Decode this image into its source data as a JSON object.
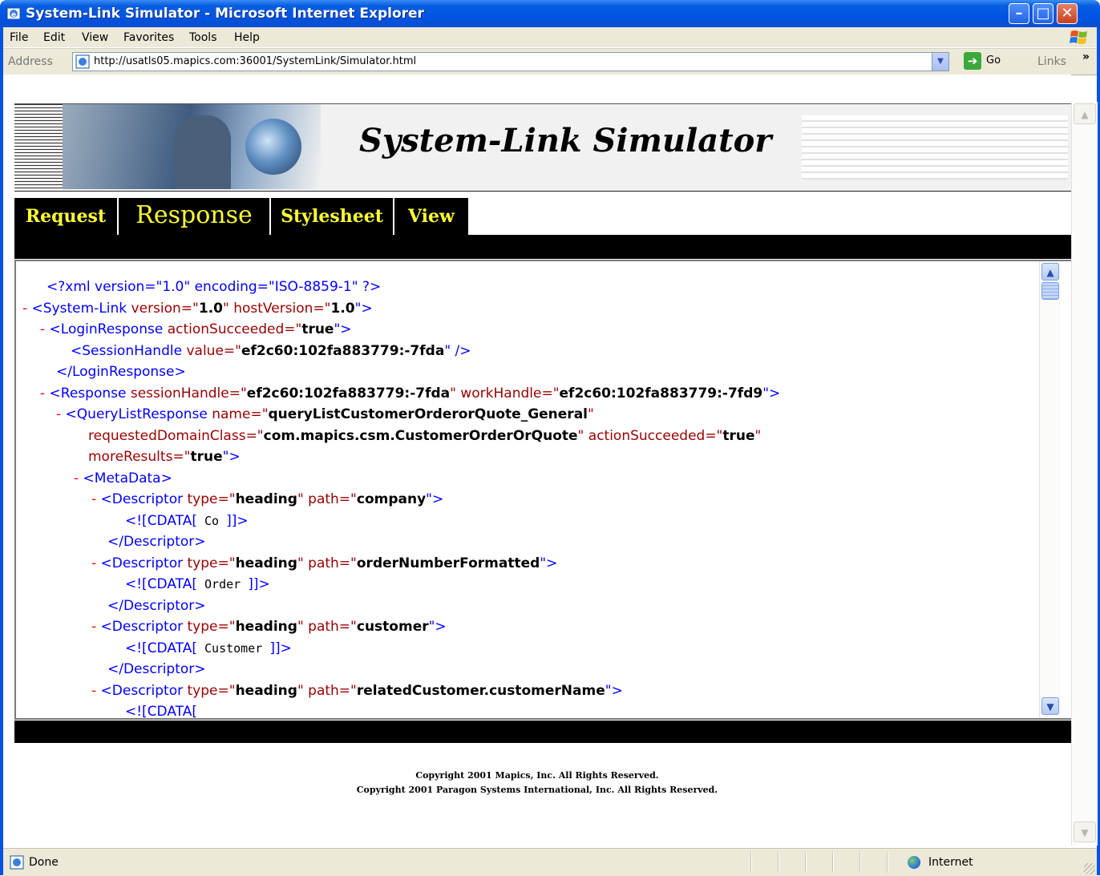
{
  "window": {
    "title": "System-Link Simulator - Microsoft Internet Explorer",
    "min_glyph": "–",
    "max_glyph": "□",
    "close_glyph": "✕"
  },
  "menu": [
    "File",
    "Edit",
    "View",
    "Favorites",
    "Tools",
    "Help"
  ],
  "address": {
    "label": "Address",
    "url": "http://usatls05.mapics.com:36001/SystemLink/Simulator.html",
    "dropdown_glyph": "▼",
    "go_label": "Go",
    "go_glyph": "➔",
    "links_label": "Links",
    "links_chevron": "»"
  },
  "banner": {
    "title": "System-Link Simulator"
  },
  "tabs": [
    "Request",
    "Response",
    "Stylesheet",
    "View"
  ],
  "xml": {
    "decl": "<?xml version=\"1.0\" encoding=\"ISO-8859-1\" ?>",
    "minus": "-",
    "l2_open": "<System-Link ",
    "l2_attr1": "version=\"",
    "l2_val1": "1.0",
    "l2_attr2": "\" hostVersion=\"",
    "l2_val2": "1.0",
    "l2_close": "\">",
    "l3_open": "<LoginResponse ",
    "l3_attr": "actionSucceeded=\"",
    "l3_val": "true",
    "l3_close": "\">",
    "l4_open": "<SessionHandle ",
    "l4_attr": "value=\"",
    "l4_val": "ef2c60:102fa883779:-7fda",
    "l4_close": "\" />",
    "l5": "</LoginResponse>",
    "l6_open": "<Response ",
    "l6_attr1": "sessionHandle=\"",
    "l6_val1": "ef2c60:102fa883779:-7fda",
    "l6_attr2": "\" workHandle=\"",
    "l6_val2": "ef2c60:102fa883779:-7fd9",
    "l6_close": "\">",
    "l7_open": "<QueryListResponse ",
    "l7_attr": "name=\"",
    "l7_val": "queryListCustomerOrderorQuote_General",
    "l7_q": "\"",
    "l8_attr1": "requestedDomainClass=\"",
    "l8_val1": "com.mapics.csm.CustomerOrderOrQuote",
    "l8_attr2": "\" actionSucceeded=\"",
    "l8_val2": "true",
    "l8_q": "\"",
    "l9_attr": "moreResults=\"",
    "l9_val": "true",
    "l9_close": "\">",
    "l10": "<MetaData>",
    "desc_open": "<Descriptor ",
    "desc_type": "type=\"",
    "desc_heading": "heading",
    "desc_path": "\" path=\"",
    "desc_close": "\">",
    "desc_end": "</Descriptor>",
    "cdata_open": "<![CDATA[",
    "cdata_close": "]]>",
    "path1": "company",
    "cdata1": " Co  ",
    "path2": "orderNumberFormatted",
    "cdata2": " Order  ",
    "path3": "customer",
    "cdata3": " Customer  ",
    "path4": "relatedCustomer.customerName"
  },
  "footer": {
    "line1": "Copyright 2001 Mapics, Inc. All Rights Reserved.",
    "line2": "Copyright 2001 Paragon Systems International, Inc. All Rights Reserved."
  },
  "status": {
    "text": "Done",
    "zone": "Internet"
  },
  "colors": {
    "xml_tag": "#0000ff",
    "xml_attr": "#990000",
    "tab_text": "#ffff33",
    "titlebar": "#0054e3"
  }
}
